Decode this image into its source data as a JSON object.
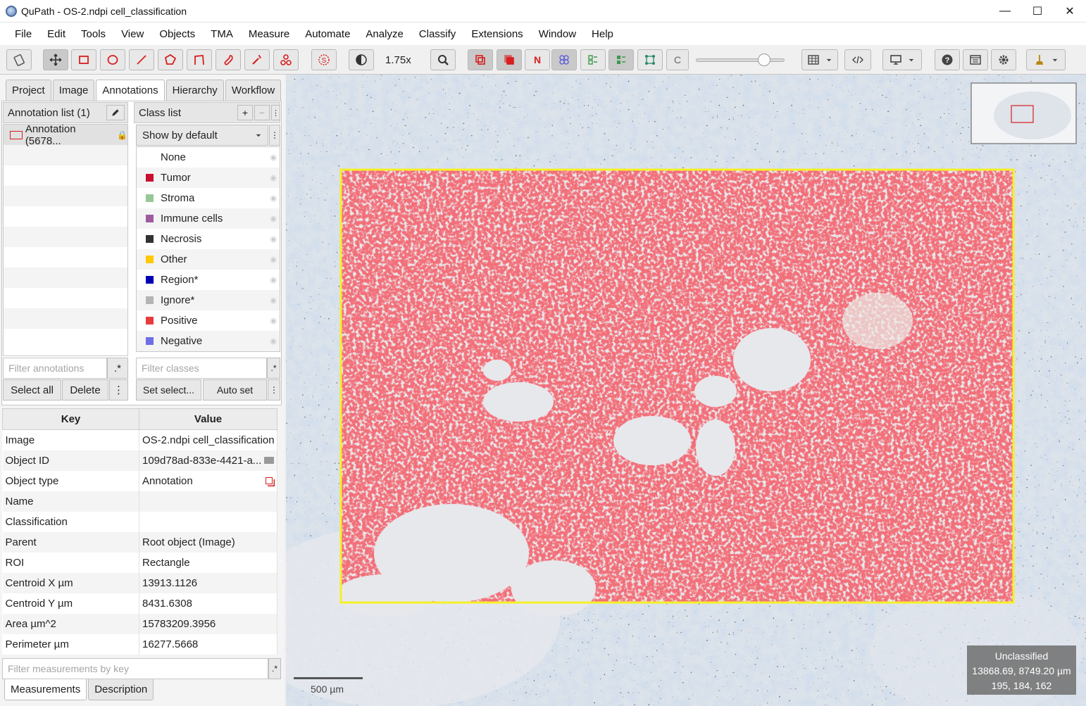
{
  "window": {
    "title": "QuPath - OS-2.ndpi cell_classification",
    "minimize_glyph": "—",
    "maximize_glyph": "☐",
    "close_glyph": "✕"
  },
  "menu": [
    "File",
    "Edit",
    "Tools",
    "View",
    "Objects",
    "TMA",
    "Measure",
    "Automate",
    "Analyze",
    "Classify",
    "Extensions",
    "Window",
    "Help"
  ],
  "toolbar": {
    "zoom": "1.75x",
    "count_nuclei_label": "N",
    "channel_label": "C"
  },
  "tabs": [
    "Project",
    "Image",
    "Annotations",
    "Hierarchy",
    "Workflow"
  ],
  "annotations": {
    "header": "Annotation list (1)",
    "items": [
      "Annotation (5678..."
    ],
    "filter_placeholder": "Filter annotations",
    "regex_label": ".*",
    "select_all": "Select all",
    "delete": "Delete",
    "more": "⋮"
  },
  "classes": {
    "header": "Class list",
    "add": "+",
    "remove": "−",
    "more": "⋮",
    "show_mode": "Show by default",
    "items": [
      {
        "name": "None",
        "color": ""
      },
      {
        "name": "Tumor",
        "color": "#c8102e"
      },
      {
        "name": "Stroma",
        "color": "#96c896"
      },
      {
        "name": "Immune cells",
        "color": "#a05aa0"
      },
      {
        "name": "Necrosis",
        "color": "#323232"
      },
      {
        "name": "Other",
        "color": "#ffc800"
      },
      {
        "name": "Region*",
        "color": "#0000b4"
      },
      {
        "name": "Ignore*",
        "color": "#b4b4b4"
      },
      {
        "name": "Positive",
        "color": "#e63c3c"
      },
      {
        "name": "Negative",
        "color": "#6e6ee6"
      }
    ],
    "filter_placeholder": "Filter classes",
    "regex_label": ".*",
    "set_selected": "Set select...",
    "auto_set": "Auto set"
  },
  "measurements": {
    "key_header": "Key",
    "value_header": "Value",
    "rows": [
      {
        "key": "Image",
        "value": "OS-2.ndpi cell_classification"
      },
      {
        "key": "Object ID",
        "value": "109d78ad-833e-4421-a..."
      },
      {
        "key": "Object type",
        "value": "Annotation"
      },
      {
        "key": "Name",
        "value": ""
      },
      {
        "key": "Classification",
        "value": ""
      },
      {
        "key": "Parent",
        "value": "Root object (Image)"
      },
      {
        "key": "ROI",
        "value": "Rectangle"
      },
      {
        "key": "Centroid X µm",
        "value": "13913.1126"
      },
      {
        "key": "Centroid Y µm",
        "value": "8431.6308"
      },
      {
        "key": "Area µm^2",
        "value": "15783209.3956"
      },
      {
        "key": "Perimeter µm",
        "value": "16277.5668"
      }
    ],
    "filter_placeholder": "Filter measurements by key",
    "regex_label": ".*",
    "tabs": [
      "Measurements",
      "Description"
    ]
  },
  "viewer": {
    "scalebar_label": "500 µm",
    "cursor_class": "Unclassified",
    "cursor_coords": "13868.69, 8749.20 µm",
    "cursor_rgb": "195, 184, 162",
    "annotation_color": "#f5f028",
    "positive_color": "#e32a30"
  }
}
